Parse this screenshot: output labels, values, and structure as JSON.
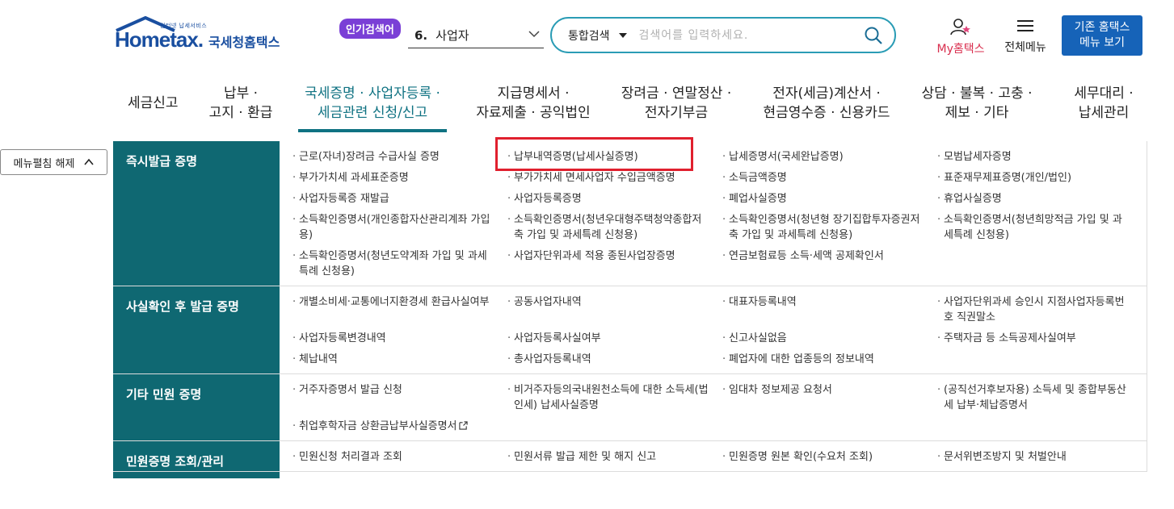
{
  "header": {
    "logo_small": "인터넷 납세서비스",
    "logo_word": "Hometax.",
    "logo_ko": "국세청홈택스",
    "popular_badge": "인기검색어",
    "popular_number": "6.",
    "popular_keyword": "사업자",
    "search_scope": "통합검색",
    "search_placeholder": "검색어를 입력하세요.",
    "my_hometax": "My홈택스",
    "all_menu": "전체메뉴",
    "old_home_line1": "기존 홈택스",
    "old_home_line2": "메뉴 보기"
  },
  "gnb": [
    {
      "l1": "세금신고",
      "l2": ""
    },
    {
      "l1": "납부 ·",
      "l2": "고지 · 환급"
    },
    {
      "l1": "국세증명 · 사업자등록 ·",
      "l2": "세금관련 신청/신고"
    },
    {
      "l1": "지급명세서 ·",
      "l2": "자료제출 · 공익법인"
    },
    {
      "l1": "장려금 · 연말정산 ·",
      "l2": "전자기부금"
    },
    {
      "l1": "전자(세금)계산서 ·",
      "l2": "현금영수증 · 신용카드"
    },
    {
      "l1": "상담 · 불복 · 고충 ·",
      "l2": "제보 · 기타"
    },
    {
      "l1": "세무대리 ·",
      "l2": "납세관리"
    }
  ],
  "collapse_button": "메뉴펼침 해제",
  "sections": [
    {
      "title": "즉시발급 증명",
      "items": [
        "근로(자녀)장려금 수급사실 증명",
        "납부내역증명(납세사실증명)",
        "납세증명서(국세완납증명)",
        "모범납세자증명",
        "부가가치세 과세표준증명",
        "부가가치세 면세사업자 수입금액증명",
        "소득금액증명",
        "표준재무제표증명(개인/법인)",
        "사업자등록증 재발급",
        "사업자등록증명",
        "폐업사실증명",
        "휴업사실증명",
        "소득확인증명서(개인종합자산관리계좌 가입용)",
        "소득확인증명서(청년우대형주택청약종합저축 가입 및 과세특례 신청용)",
        "소득확인증명서(청년형 장기집합투자증권저축 가입 및 과세특례 신청용)",
        "소득확인증명서(청년희망적금 가입 및 과세특례 신청용)",
        "소득확인증명서(청년도약계좌 가입 및 과세특례 신청용)",
        "사업자단위과세 적용 종된사업장증명",
        "연금보험료등 소득·세액 공제확인서"
      ]
    },
    {
      "title": "사실확인 후 발급 증명",
      "items": [
        "개별소비세·교통에너지환경세 환급사실여부",
        "공동사업자내역",
        "대표자등록내역",
        "사업자단위과세 승인시 지점사업자등록번호 직권말소",
        "사업자등록변경내역",
        "사업자등록사실여부",
        "신고사실없음",
        "주택자금 등 소득공제사실여부",
        "체납내역",
        "총사업자등록내역",
        "폐업자에 대한 업종등의 정보내역"
      ]
    },
    {
      "title": "기타 민원 증명",
      "items": [
        "거주자증명서 발급 신청",
        "비거주자등의국내원천소득에 대한 소득세(법인세) 납세사실증명",
        "임대차 정보제공 요청서",
        "(공직선거후보자용) 소득세 및 종합부동산세 납부·체납증명서",
        "취업후학자금 상환금납부사실증명서"
      ]
    },
    {
      "title": "민원증명 조회/관리",
      "items": [
        "민원신청 처리결과 조회",
        "민원서류 발급 제한 및 해지 신고",
        "민원증명 원본 확인(수요처 조회)",
        "문서위변조방지 및 처벌안내"
      ]
    }
  ],
  "colors": {
    "brand": "#1a4fa0",
    "teal": "#0f6872",
    "highlight": "#e0202e",
    "badge": "#7a3fd6"
  }
}
